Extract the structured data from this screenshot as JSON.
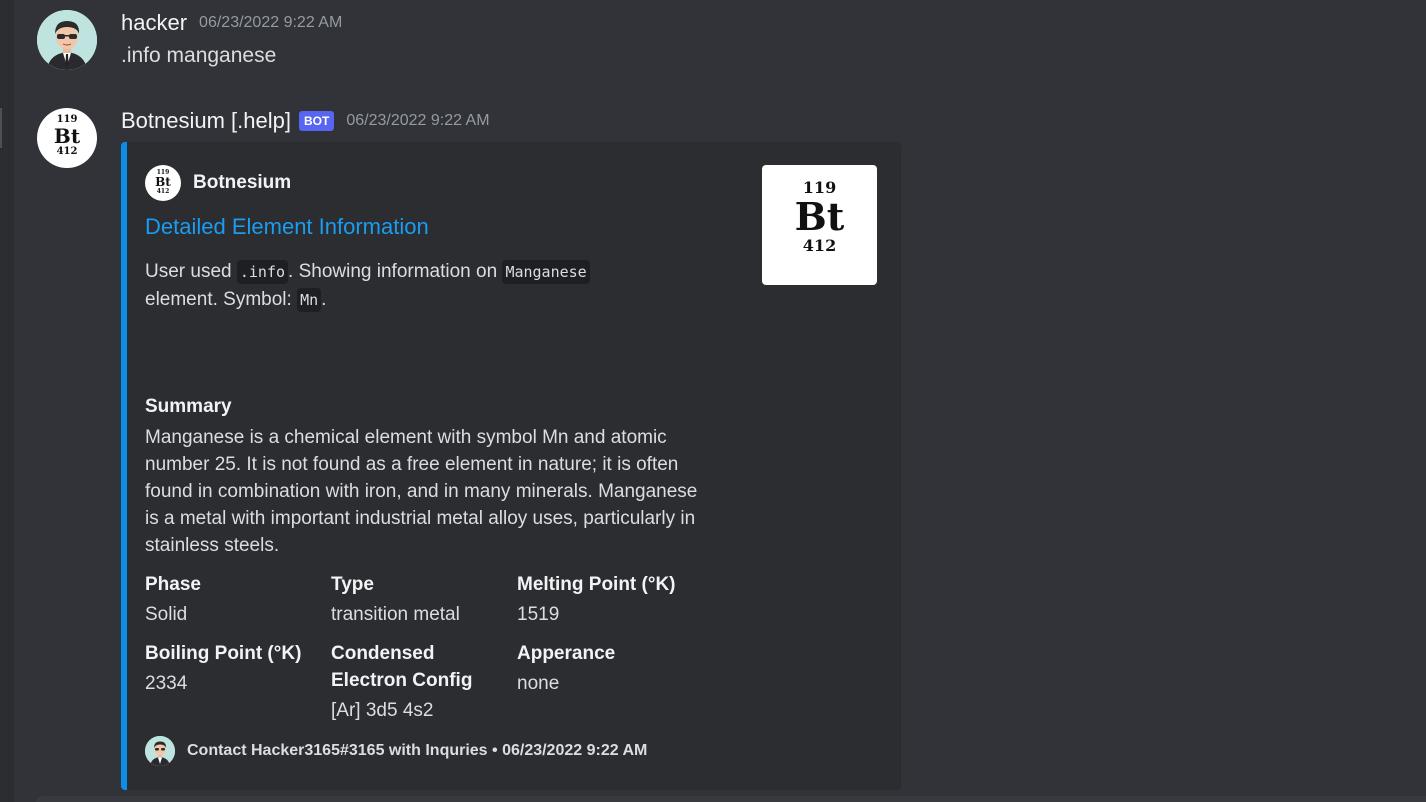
{
  "messages": [
    {
      "author": "hacker",
      "timestamp": "06/23/2022 9:22 AM",
      "content": ".info manganese",
      "avatar_icon": "hacker-avatar"
    },
    {
      "author": "Botnesium [.help]",
      "bot_tag": "BOT",
      "timestamp": "06/23/2022 9:22 AM",
      "avatar_icon": "bt-element-avatar",
      "avatar_text": {
        "top": "119",
        "symbol": "Bt",
        "bottom": "412"
      }
    }
  ],
  "embed": {
    "accent_color": "#0b8ee8",
    "author_name": "Botnesium",
    "title": "Detailed Element Information",
    "description": {
      "part1": "User used ",
      "code1": ".info",
      "part2": ". Showing information on ",
      "code2": "Manganese",
      "part3": "element. Symbol: ",
      "code3": "Mn",
      "part4": "."
    },
    "thumbnail": {
      "top": "119",
      "symbol": "Bt",
      "bottom": "412"
    },
    "summary": {
      "name": "Summary",
      "value": "Manganese is a chemical element with symbol Mn and atomic number 25. It is not found as a free element in nature; it is often found in combination with iron, and in many minerals. Manganese is a metal with important industrial metal alloy uses, particularly in stainless steels."
    },
    "fields": [
      {
        "name": "Phase",
        "value": "Solid"
      },
      {
        "name": "Type",
        "value": "transition metal"
      },
      {
        "name": "Melting Point (°K)",
        "value": "1519"
      },
      {
        "name": "Boiling Point (°K)",
        "value": "2334"
      },
      {
        "name": "Condensed Electron Config",
        "value": "[Ar] 3d5 4s2"
      },
      {
        "name": "Apperance",
        "value": "none"
      }
    ],
    "footer": {
      "text": "Contact Hacker3165#3165 with Inquries • 06/23/2022 9:22 AM"
    }
  }
}
